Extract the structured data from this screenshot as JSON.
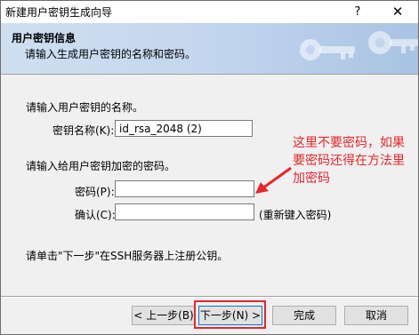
{
  "window": {
    "title": "新建用户密钥生成向导",
    "help_glyph": "?",
    "close_glyph": "✕"
  },
  "header": {
    "title": "用户密钥信息",
    "subtitle": "请输入生成用户密钥的名称和密码。"
  },
  "key_name": {
    "section_label": "请输入用户密钥的名称。",
    "field_label": "密钥名称(K):",
    "value": "id_rsa_2048 (2)"
  },
  "passphrase": {
    "section_label": "请输入给用户密钥加密的密码。",
    "password_label": "密码(P):",
    "password_value": "",
    "confirm_label": "确认(C):",
    "confirm_value": "",
    "confirm_hint": "(重新键入密码)"
  },
  "instruction": "请单击\"下一步\"在SSH服务器上注册公钥。",
  "annotation": {
    "text": "这里不要密码，如果要密码还得在方法里加密码",
    "color": "#e8262a"
  },
  "buttons": {
    "back": "< 上一步(B)",
    "next": "下一步(N) >",
    "finish": "完成",
    "cancel": "取消"
  },
  "colors": {
    "accent": "#0078d7",
    "annotation": "#e8262a",
    "header_gradient_start": "#cfdff1",
    "header_gradient_end": "#a9c3e4"
  }
}
